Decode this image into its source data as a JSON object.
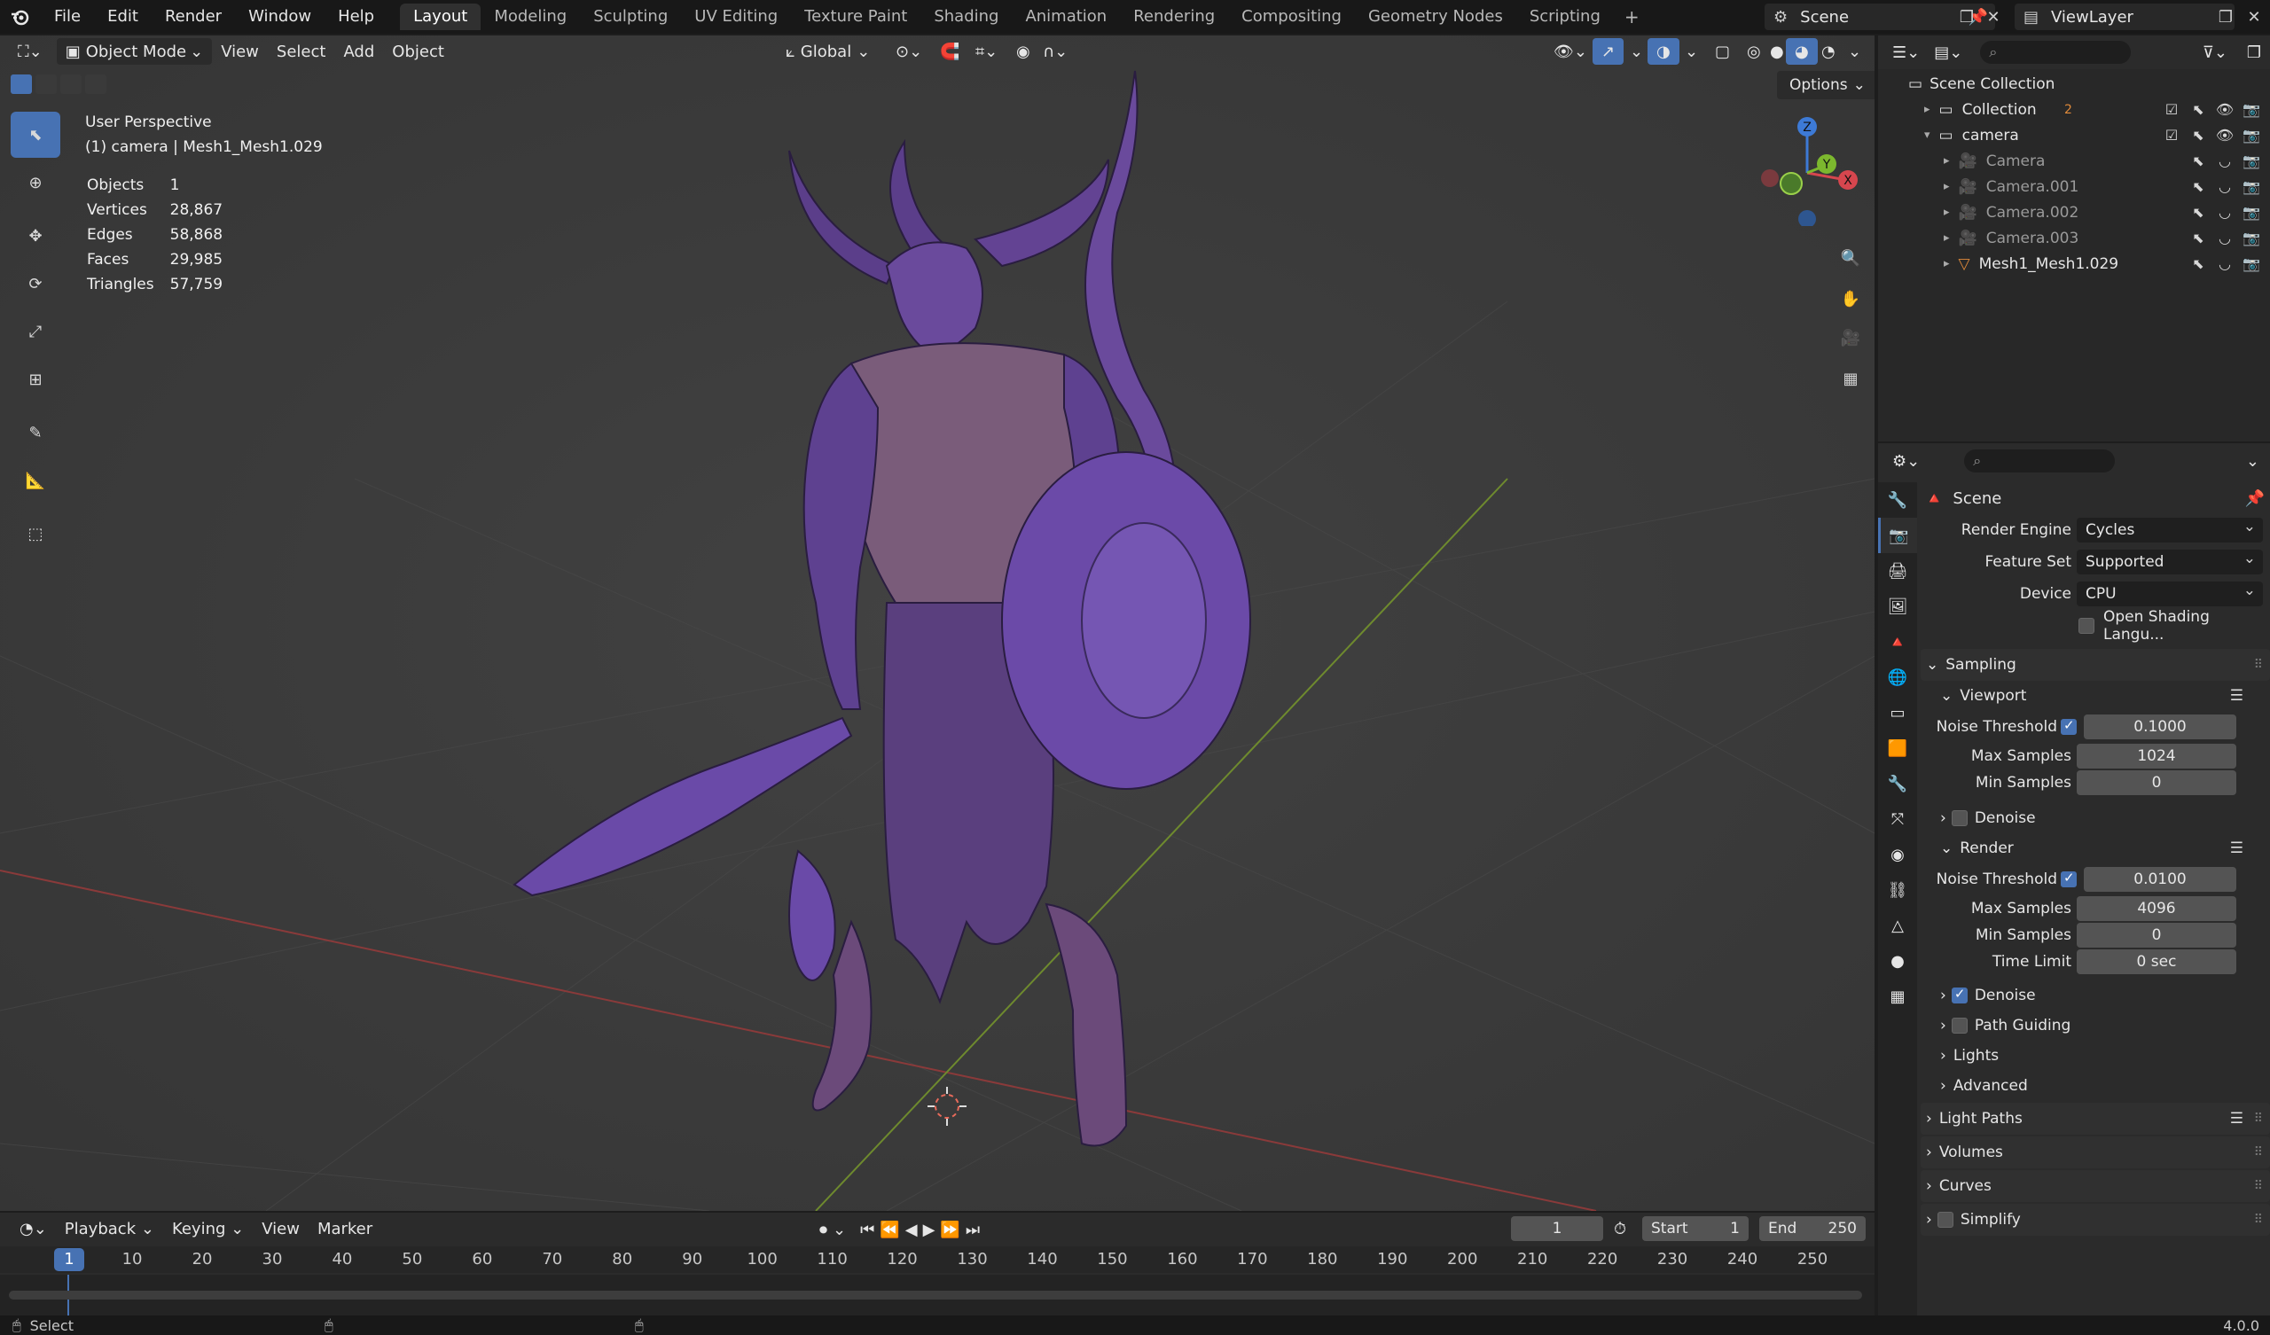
{
  "topbar": {
    "menus": [
      "File",
      "Edit",
      "Render",
      "Window",
      "Help"
    ],
    "workspaces": [
      "Layout",
      "Modeling",
      "Sculpting",
      "UV Editing",
      "Texture Paint",
      "Shading",
      "Animation",
      "Rendering",
      "Compositing",
      "Geometry Nodes",
      "Scripting"
    ],
    "active_workspace": "Layout",
    "scene": "Scene",
    "view_layer": "ViewLayer"
  },
  "viewport": {
    "mode": "Object Mode",
    "menus": [
      "View",
      "Select",
      "Add",
      "Object"
    ],
    "orientation": "Global",
    "options": "Options",
    "view_name": "User Perspective",
    "active_object": "(1) camera | Mesh1_Mesh1.029",
    "stats": [
      {
        "label": "Objects",
        "value": "1"
      },
      {
        "label": "Vertices",
        "value": "28,867"
      },
      {
        "label": "Edges",
        "value": "58,868"
      },
      {
        "label": "Faces",
        "value": "29,985"
      },
      {
        "label": "Triangles",
        "value": "57,759"
      }
    ],
    "gizmo": {
      "z": "Z",
      "y": "Y",
      "x": "X"
    }
  },
  "timeline": {
    "menus": [
      "Playback",
      "Keying",
      "View",
      "Marker"
    ],
    "current_frame": "1",
    "start_label": "Start",
    "start": "1",
    "end_label": "End",
    "end": "250",
    "ruler_marks": [
      "1",
      "10",
      "20",
      "30",
      "40",
      "50",
      "60",
      "70",
      "80",
      "90",
      "100",
      "110",
      "120",
      "130",
      "140",
      "150",
      "160",
      "170",
      "180",
      "190",
      "200",
      "210",
      "220",
      "230",
      "240",
      "250"
    ]
  },
  "statusbar": {
    "left": "Select",
    "version": "4.0.0"
  },
  "outliner": {
    "root": "Scene Collection",
    "rows": [
      {
        "label": "Collection",
        "level": 1,
        "dim": false
      },
      {
        "label": "camera",
        "level": 1,
        "dim": false
      },
      {
        "label": "Camera",
        "level": 2,
        "dim": true
      },
      {
        "label": "Camera.001",
        "level": 2,
        "dim": true
      },
      {
        "label": "Camera.002",
        "level": 2,
        "dim": true
      },
      {
        "label": "Camera.003",
        "level": 2,
        "dim": true
      },
      {
        "label": "Mesh1_Mesh1.029",
        "level": 2,
        "dim": false
      }
    ],
    "collection_badge": "2"
  },
  "properties": {
    "context": "Scene",
    "render_engine_label": "Render Engine",
    "render_engine": "Cycles",
    "feature_set_label": "Feature Set",
    "feature_set": "Supported",
    "device_label": "Device",
    "device": "CPU",
    "osl_label": "Open Shading Langu...",
    "sampling": "Sampling",
    "viewport": "Viewport",
    "noise_threshold_label": "Noise Threshold",
    "vp_noise_threshold": "0.1000",
    "max_samples_label": "Max Samples",
    "vp_max_samples": "1024",
    "min_samples_label": "Min Samples",
    "vp_min_samples": "0",
    "denoise": "Denoise",
    "render": "Render",
    "r_noise_threshold": "0.0100",
    "r_max_samples": "4096",
    "r_min_samples": "0",
    "time_limit_label": "Time Limit",
    "r_time_limit": "0 sec",
    "path_guiding": "Path Guiding",
    "lights": "Lights",
    "advanced": "Advanced",
    "light_paths": "Light Paths",
    "volumes": "Volumes",
    "curves": "Curves",
    "simplify": "Simplify"
  }
}
